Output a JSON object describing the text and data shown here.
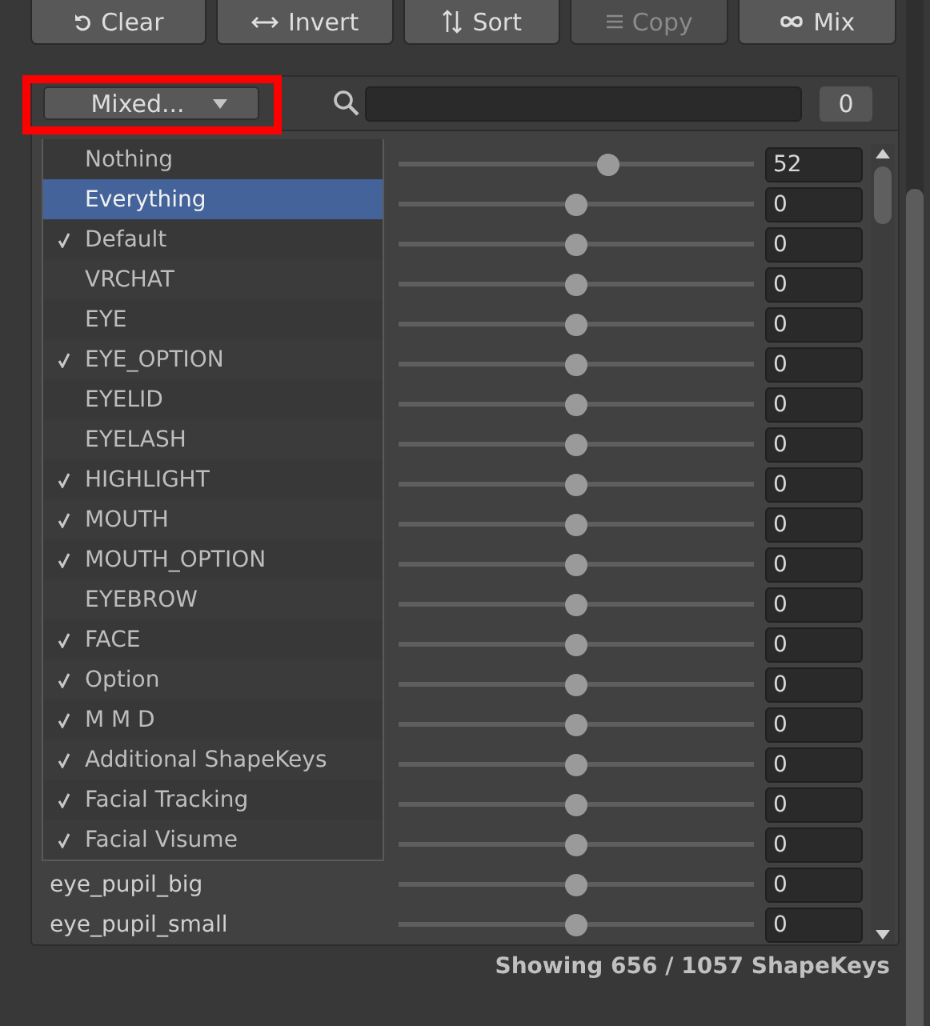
{
  "toolbar": [
    {
      "label": "Clear",
      "disabled": false
    },
    {
      "label": "Invert",
      "disabled": false
    },
    {
      "label": "Sort",
      "disabled": false
    },
    {
      "label": "Copy",
      "disabled": true
    },
    {
      "label": "Mix",
      "disabled": false
    }
  ],
  "filter_dropdown": {
    "label": "Mixed...",
    "highlighted": true
  },
  "count": "0",
  "rows": [
    {
      "value": "52",
      "level": 0.59
    },
    {
      "value": "0",
      "level": 0.5
    },
    {
      "value": "0",
      "level": 0.5
    },
    {
      "value": "0",
      "level": 0.5
    },
    {
      "value": "0",
      "level": 0.5
    },
    {
      "value": "0",
      "level": 0.5
    },
    {
      "value": "0",
      "level": 0.5
    },
    {
      "value": "0",
      "level": 0.5
    },
    {
      "value": "0",
      "level": 0.5
    },
    {
      "value": "0",
      "level": 0.5
    },
    {
      "value": "0",
      "level": 0.5
    },
    {
      "value": "0",
      "level": 0.5
    },
    {
      "value": "0",
      "level": 0.5
    },
    {
      "value": "0",
      "level": 0.5
    },
    {
      "value": "0",
      "level": 0.5
    },
    {
      "value": "0",
      "level": 0.5
    },
    {
      "value": "0",
      "level": 0.5
    },
    {
      "value": "0",
      "level": 0.5
    },
    {
      "name": "eye_pupil_big",
      "value": "0",
      "level": 0.5
    },
    {
      "name": "eye_pupil_small",
      "value": "0",
      "level": 0.5
    }
  ],
  "menu": [
    {
      "label": "Nothing",
      "checked": false,
      "selected": false
    },
    {
      "label": "Everything",
      "checked": false,
      "selected": true
    },
    {
      "label": "Default",
      "checked": true,
      "selected": false
    },
    {
      "label": "VRCHAT",
      "checked": false,
      "selected": false
    },
    {
      "label": "EYE",
      "checked": false,
      "selected": false
    },
    {
      "label": "EYE_OPTION",
      "checked": true,
      "selected": false
    },
    {
      "label": "EYELID",
      "checked": false,
      "selected": false
    },
    {
      "label": "EYELASH",
      "checked": false,
      "selected": false
    },
    {
      "label": "HIGHLIGHT",
      "checked": true,
      "selected": false
    },
    {
      "label": "MOUTH",
      "checked": true,
      "selected": false
    },
    {
      "label": "MOUTH_OPTION",
      "checked": true,
      "selected": false
    },
    {
      "label": "EYEBROW",
      "checked": false,
      "selected": false
    },
    {
      "label": "FACE",
      "checked": true,
      "selected": false
    },
    {
      "label": "Option",
      "checked": true,
      "selected": false
    },
    {
      "label": "M M D",
      "checked": true,
      "selected": false
    },
    {
      "label": "Additional ShapeKeys",
      "checked": true,
      "selected": false
    },
    {
      "label": "Facial Tracking",
      "checked": true,
      "selected": false
    },
    {
      "label": "Facial Visume",
      "checked": true,
      "selected": false
    }
  ],
  "status": "Showing 656 / 1057 ShapeKeys"
}
